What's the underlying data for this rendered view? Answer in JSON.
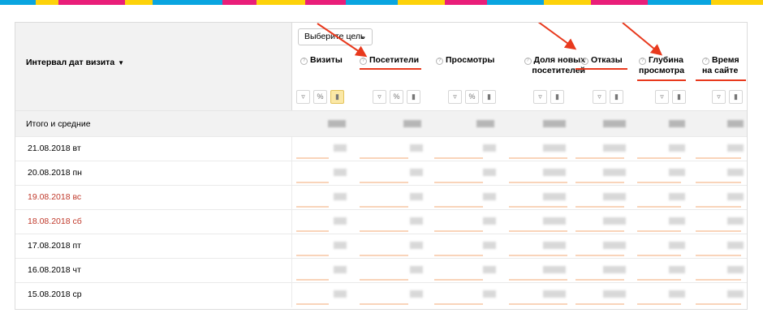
{
  "colors": {
    "accent_arrow": "#e8391d",
    "weekend_text": "#c0392b",
    "stripe": [
      "#0aa5e0",
      "#fdd20a",
      "#e91e79",
      "#fdd20a",
      "#0aa5e0",
      "#e91e79",
      "#fdd20a",
      "#e91e79",
      "#0aa5e0",
      "#fdd20a",
      "#e91e79",
      "#0aa5e0",
      "#fdd20a",
      "#e91e79",
      "#0aa5e0",
      "#fdd20a"
    ]
  },
  "toolbar": {
    "goal_select_label": "Выберите цель"
  },
  "table": {
    "period_header": "Интервал дат визита",
    "sort_indicator": "▼",
    "columns": [
      {
        "id": "visits",
        "label": "Визиты",
        "highlighted": false
      },
      {
        "id": "visitors",
        "label": "Посетители",
        "highlighted": true
      },
      {
        "id": "pageviews",
        "label": "Просмотры",
        "highlighted": false
      },
      {
        "id": "new_share",
        "label": "Доля новых посетителей",
        "highlighted": false
      },
      {
        "id": "bounces",
        "label": "Отказы",
        "highlighted": true
      },
      {
        "id": "depth",
        "label": "Глубина просмотра",
        "highlighted": true
      },
      {
        "id": "time",
        "label": "Время на сайте",
        "highlighted": true
      }
    ],
    "totals_label": "Итого и средние",
    "rows": [
      {
        "date": "21.08.2018 вт",
        "weekend": false
      },
      {
        "date": "20.08.2018 пн",
        "weekend": false
      },
      {
        "date": "19.08.2018 вс",
        "weekend": true
      },
      {
        "date": "18.08.2018 сб",
        "weekend": true
      },
      {
        "date": "17.08.2018 пт",
        "weekend": false
      },
      {
        "date": "16.08.2018 чт",
        "weekend": false
      },
      {
        "date": "15.08.2018 ср",
        "weekend": false
      }
    ]
  }
}
